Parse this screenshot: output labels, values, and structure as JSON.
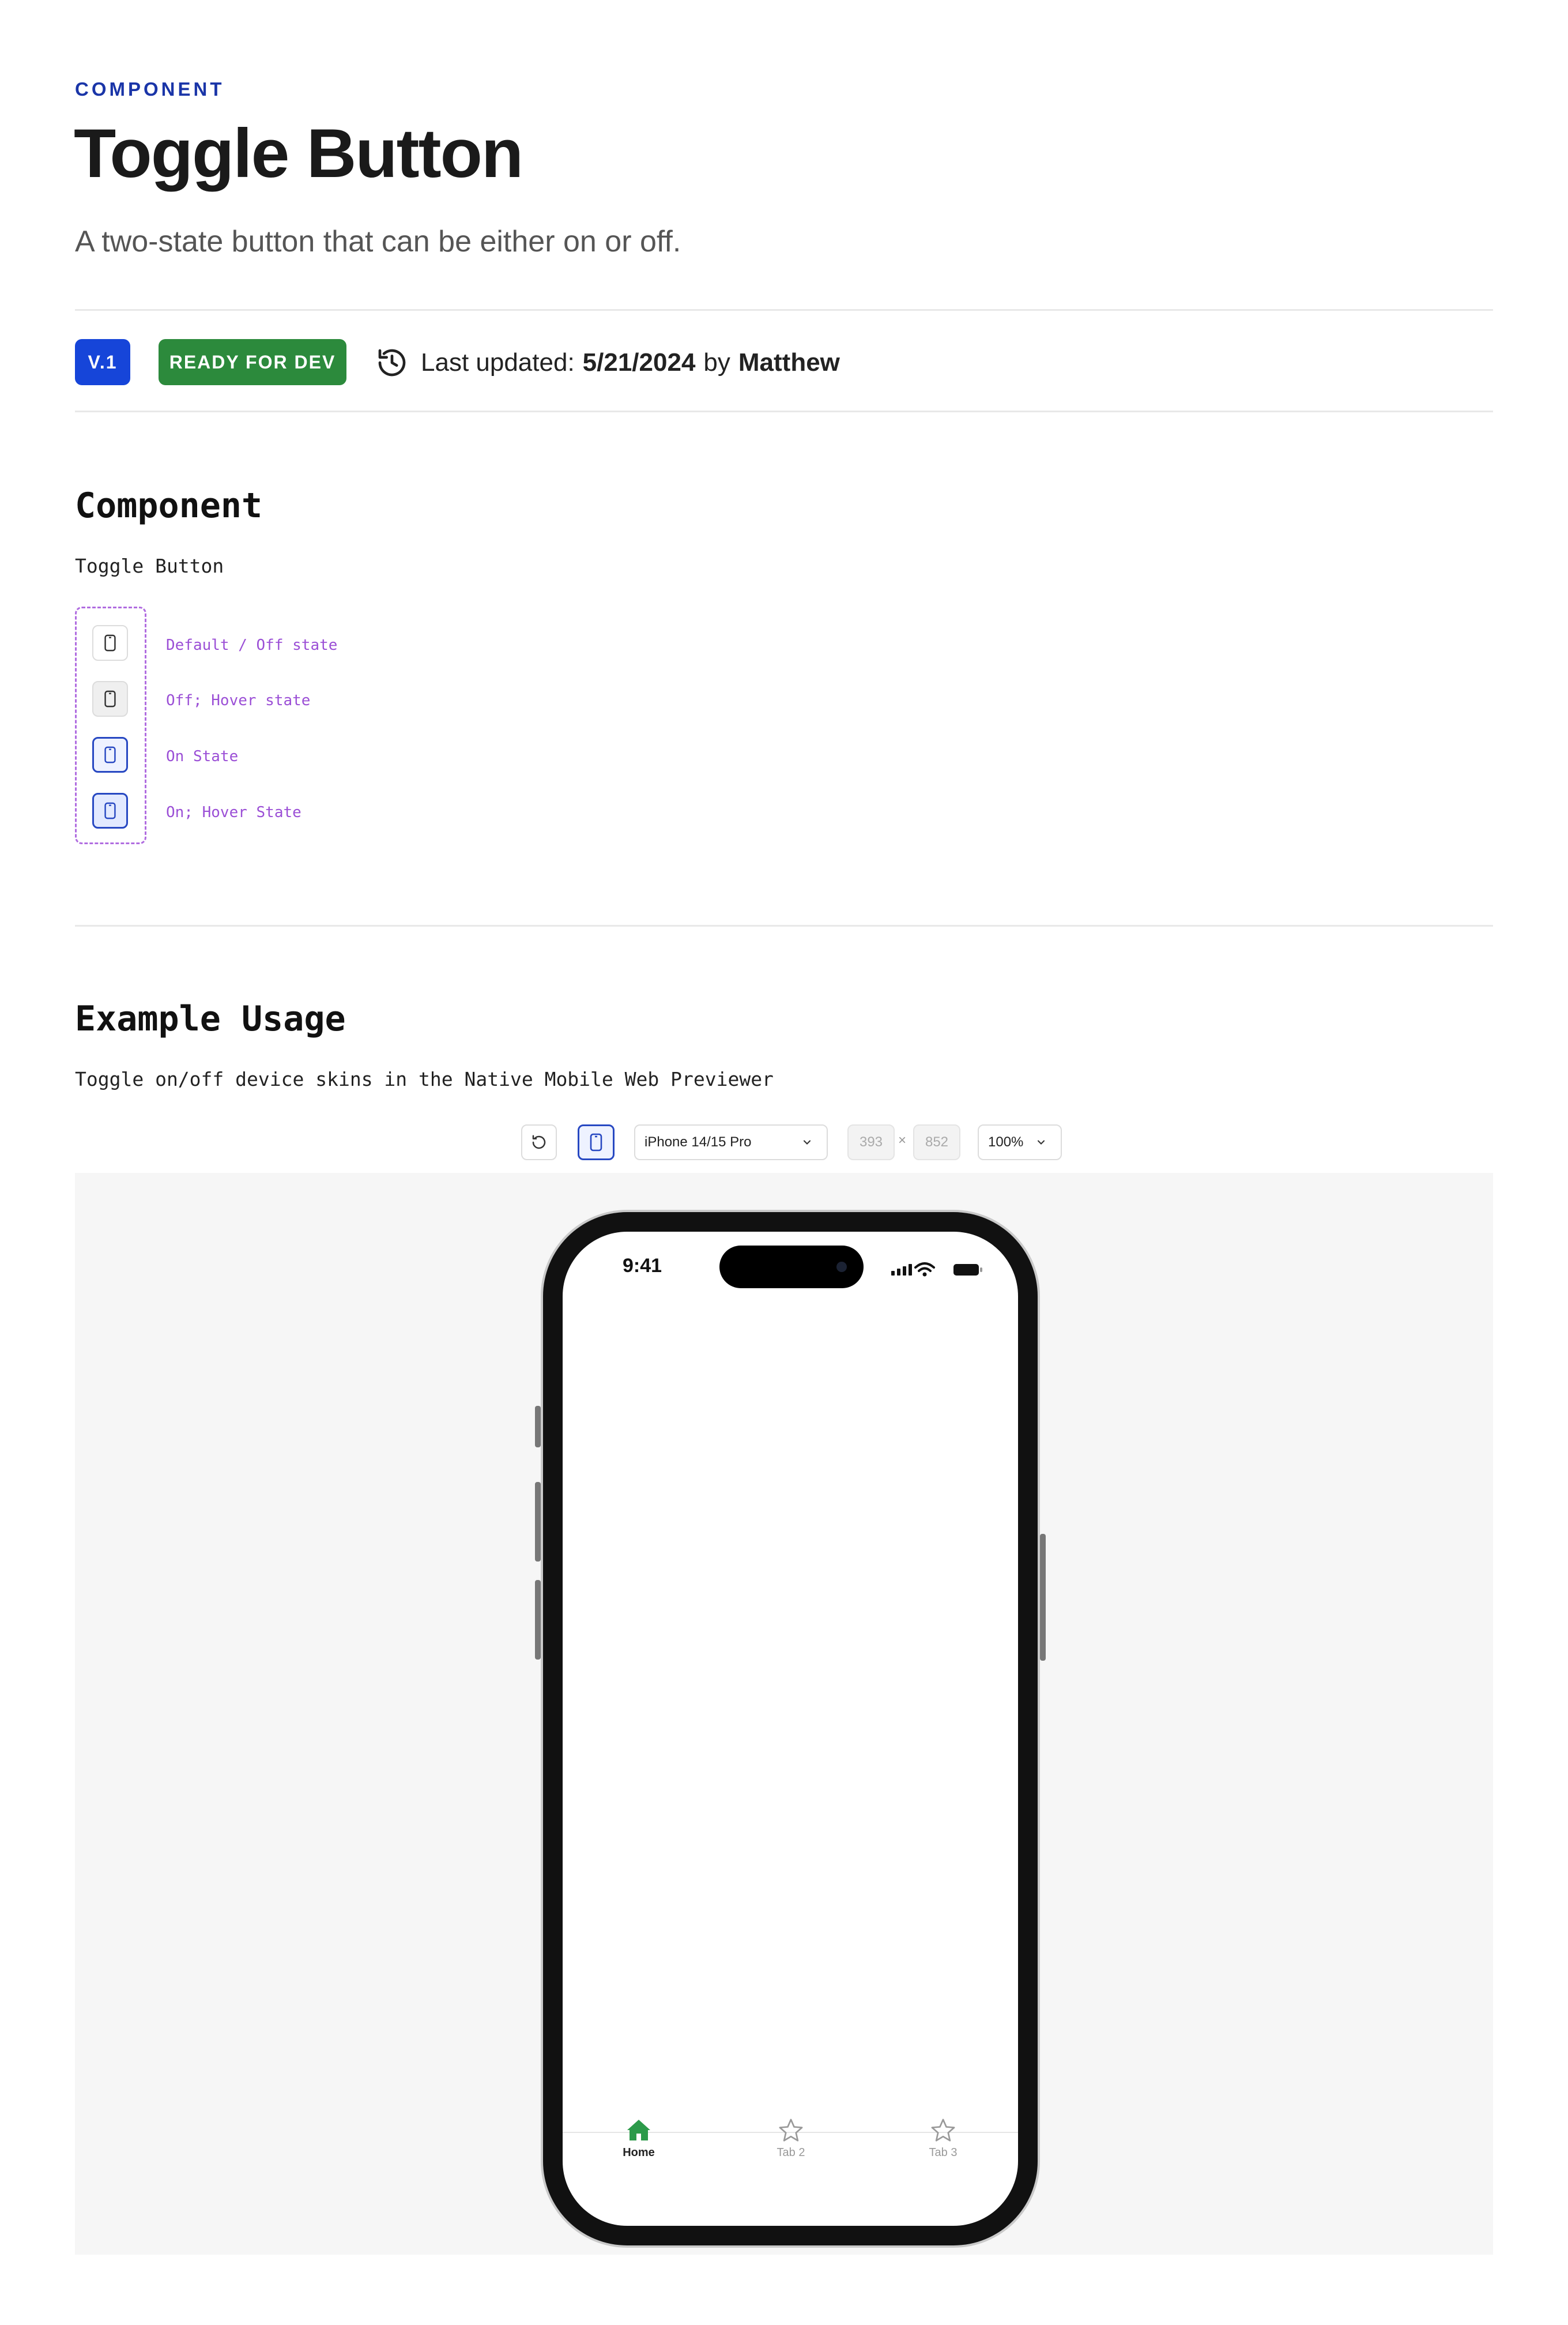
{
  "header": {
    "eyebrow": "COMPONENT",
    "title": "Toggle Button",
    "subtitle": "A two-state button that can be either on or off."
  },
  "meta": {
    "version": "V.1",
    "status": "READY FOR DEV",
    "status_color": "#2c8a3c",
    "version_color": "#1645d9",
    "updated_label": "Last updated:",
    "updated_date": "5/21/2024",
    "by_label": "by",
    "author": "Matthew",
    "icon": "history-icon"
  },
  "component_section": {
    "heading": "Component",
    "name": "Toggle Button",
    "variants": [
      {
        "label": "Default / Off state",
        "state": "off"
      },
      {
        "label": "Off; Hover state",
        "state": "off-hover"
      },
      {
        "label": "On State",
        "state": "on"
      },
      {
        "label": "On; Hover State",
        "state": "on-hover"
      }
    ],
    "icon": "device-icon"
  },
  "example_section": {
    "heading": "Example Usage",
    "description": "Toggle on/off device skins in the Native Mobile Web Previewer",
    "toolbar": {
      "rotate_icon": "rotate-icon",
      "skin_toggle_icon": "device-icon",
      "device": "iPhone 14/15 Pro",
      "width": "393",
      "times": "×",
      "height": "852",
      "zoom": "100%"
    },
    "phone": {
      "time": "9:41",
      "tabs": [
        {
          "label": "Home",
          "icon": "home-icon",
          "active": true
        },
        {
          "label": "Tab 2",
          "icon": "star-icon",
          "active": false
        },
        {
          "label": "Tab 3",
          "icon": "star-icon",
          "active": false
        }
      ],
      "accent_color": "#2c9a4a"
    }
  }
}
